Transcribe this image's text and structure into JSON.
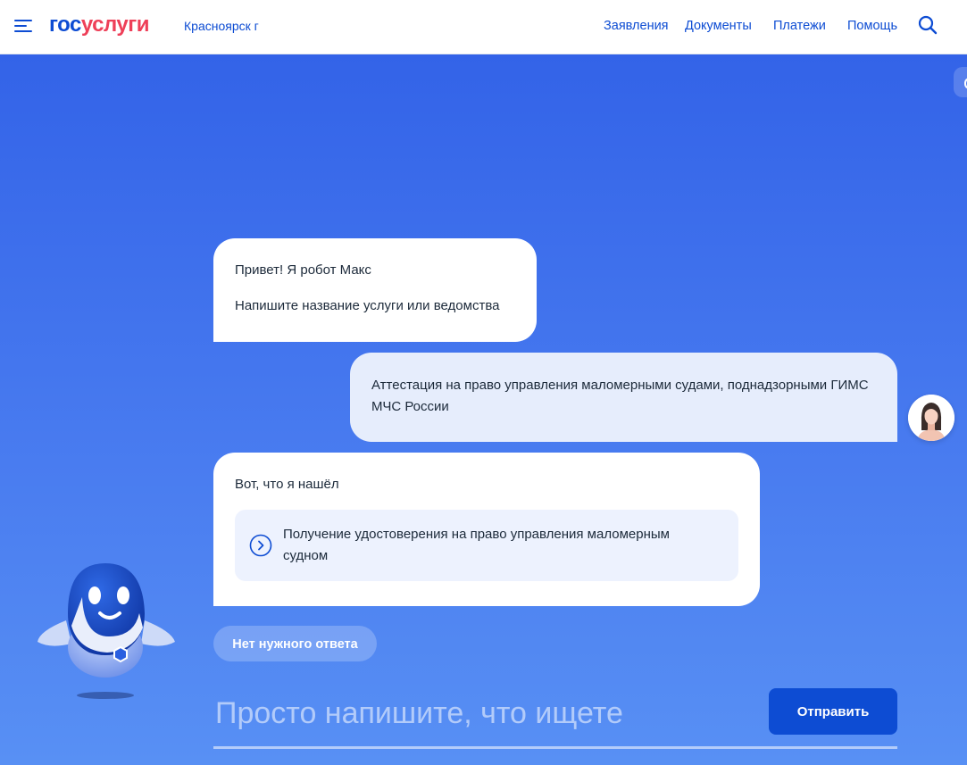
{
  "header": {
    "logo": {
      "part1": "гос",
      "part2": "услуги"
    },
    "city": "Красноярск г",
    "nav": [
      "Заявления",
      "Документы",
      "Платежи",
      "Помощь"
    ],
    "menu_icon": "hamburger-menu-icon",
    "search_icon": "search-icon"
  },
  "chat": {
    "bot_greeting": "Привет! Я робот Макс",
    "bot_prompt": "Напишите название услуги или ведомства",
    "user_message": "Аттестация на право управления маломерными судами, поднадзорными ГИМС МЧС России",
    "bot_found": "Вот, что я нашёл",
    "result_link": "Получение удостоверения на право управления маломерным судном",
    "no_answer_button": "Нет нужного ответа"
  },
  "composer": {
    "placeholder": "Просто напишите, что ищете",
    "send_label": "Отправить"
  },
  "colors": {
    "brand_blue": "#0d4cd3",
    "brand_red": "#ee3f58",
    "background_top": "#3363e8",
    "background_bottom": "#5890f4",
    "user_bubble": "#e6edfc"
  }
}
